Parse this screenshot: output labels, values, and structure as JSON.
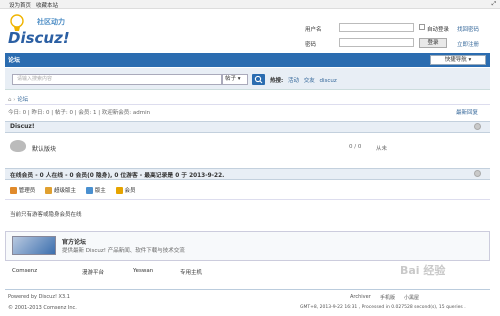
{
  "topbar": {
    "set_home": "设为首页",
    "bookmark": "收藏本站"
  },
  "logo": {
    "sub": "社区动力",
    "main": "Discuz!"
  },
  "login": {
    "username_label": "用户名",
    "password_label": "密码",
    "auto_login": "自动登录",
    "forgot": "找回密码",
    "login_btn": "登录",
    "register": "立即注册"
  },
  "nav": {
    "forum": "论坛",
    "quick_nav": "快捷导航 ▾"
  },
  "search": {
    "placeholder": "请输入搜索内容",
    "type": "帖子",
    "hot_label": "热搜:",
    "hot_items": [
      "活动",
      "交友",
      "discuz"
    ]
  },
  "breadcrumb": {
    "forum": "论坛"
  },
  "stats": {
    "text": "今日: 0 | 昨日: 0 | 帖子: 0 | 会员: 1 | 欢迎新会员: admin",
    "latest": "最新回复"
  },
  "section1": {
    "title": "Discuz!",
    "forum_name": "默认版块",
    "counts": "0 / 0",
    "last": "从未"
  },
  "online": {
    "title": "在线会员 - 0 人在线 - 0 会员(0 隐身), 0 位游客 - 最高记录是 0 于 2013-9-22.",
    "legend": [
      "管理员",
      "超级版主",
      "版主",
      "会员"
    ],
    "empty": "当前只有游客或隐身会员在线"
  },
  "links": {
    "title": "官方论坛",
    "desc": "提供最新 Discuz! 产品新闻、软件下载与技术交流",
    "partners": [
      "Comsenz",
      "漫游平台",
      "Yeswan",
      "专用主机"
    ]
  },
  "footer": {
    "powered": "Powered by Discuz! X3.1",
    "copyright": "© 2001-2013 Comsenz Inc.",
    "archiver": "Archiver",
    "mobile": "手机版",
    "blackroom": "小黑屋",
    "stat": "GMT+8, 2013-9-22 16:31 , Processed in 0.027528 second(s), 15 queries ."
  },
  "watermark": "Bai 经验",
  "colors": {
    "nav": "#2b6cb0",
    "link": "#336699",
    "head_bg": "#e8eef5"
  }
}
